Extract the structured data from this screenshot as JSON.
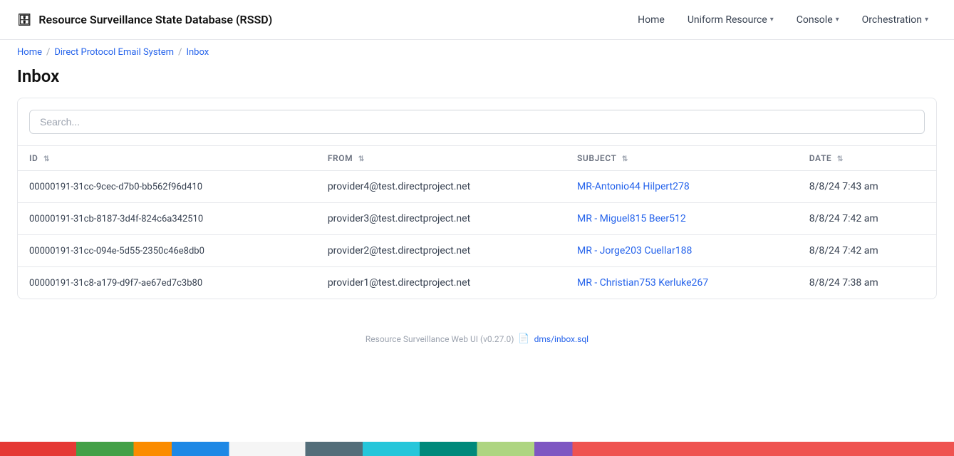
{
  "app": {
    "brand_icon": "🗄",
    "title": "Resource Surveillance State Database (RSSD)"
  },
  "nav": {
    "home_label": "Home",
    "uniform_resource_label": "Uniform Resource",
    "console_label": "Console",
    "orchestration_label": "Orchestration"
  },
  "breadcrumb": {
    "home": "Home",
    "direct_protocol": "Direct Protocol Email System",
    "current": "Inbox"
  },
  "page": {
    "title": "Inbox"
  },
  "search": {
    "placeholder": "Search..."
  },
  "table": {
    "columns": [
      {
        "key": "id",
        "label": "ID",
        "sortable": true
      },
      {
        "key": "from",
        "label": "FROM",
        "sortable": true
      },
      {
        "key": "subject",
        "label": "SUBJECT",
        "sortable": true
      },
      {
        "key": "date",
        "label": "DATE",
        "sortable": true
      }
    ],
    "rows": [
      {
        "id": "00000191-31cc-9cec-d7b0-bb562f96d410",
        "from": "provider4@test.directproject.net",
        "subject": "MR-Antonio44 Hilpert278",
        "date": "8/8/24 7:43 am"
      },
      {
        "id": "00000191-31cb-8187-3d4f-824c6a342510",
        "from": "provider3@test.directproject.net",
        "subject": "MR - Miguel815 Beer512",
        "date": "8/8/24 7:42 am"
      },
      {
        "id": "00000191-31cc-094e-5d55-2350c46e8db0",
        "from": "provider2@test.directproject.net",
        "subject": "MR - Jorge203 Cuellar188",
        "date": "8/8/24 7:42 am"
      },
      {
        "id": "00000191-31c8-a179-d9f7-ae67ed7c3b80",
        "from": "provider1@test.directproject.net",
        "subject": "MR - Christian753 Kerluke267",
        "date": "8/8/24 7:38 am"
      }
    ]
  },
  "footer": {
    "label": "Resource Surveillance Web UI (v0.27.0)",
    "link_text": "dms/inbox.sql",
    "link_href": "#"
  }
}
